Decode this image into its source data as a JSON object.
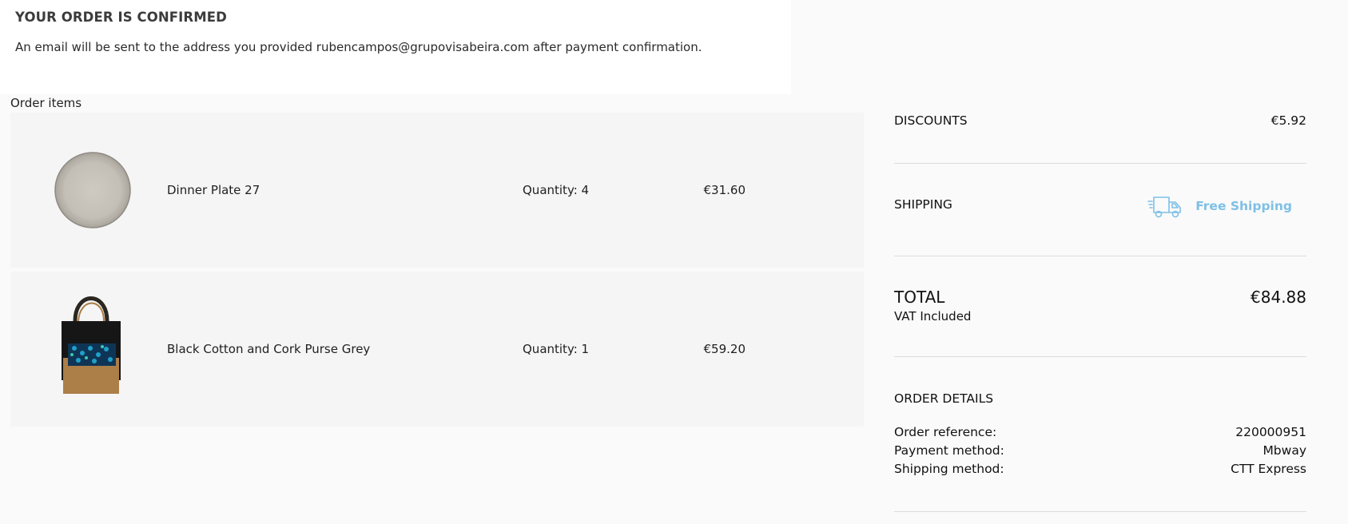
{
  "confirmation": {
    "title": "YOUR ORDER IS CONFIRMED",
    "message": "An email will be sent to the address you provided rubencampos@grupovisabeira.com after payment confirmation."
  },
  "order_items_label": "Order items",
  "items": [
    {
      "name": "Dinner Plate 27",
      "quantity": "Quantity: 4",
      "price": "€31.60",
      "image": "dinner-plate"
    },
    {
      "name": "Black Cotton and Cork Purse Grey",
      "quantity": "Quantity: 1",
      "price": "€59.20",
      "image": "tote-bag"
    }
  ],
  "summary": {
    "discounts_label": "DISCOUNTS",
    "discounts_value": "€5.92",
    "shipping_label": "SHIPPING",
    "shipping_value": "Free Shipping",
    "shipping_icon": "delivery-truck-icon",
    "total_label": "TOTAL",
    "total_value": "€84.88",
    "vat_note": "VAT Included"
  },
  "order_details": {
    "title": "ORDER DETAILS",
    "rows": [
      {
        "label": "Order reference:",
        "value": "220000951"
      },
      {
        "label": "Payment method:",
        "value": "Mbway"
      },
      {
        "label": "Shipping method:",
        "value": "CTT Express"
      }
    ]
  },
  "colors": {
    "free_shipping": "#7ec0e6",
    "divider": "#dcdcdc",
    "background": "#fafafa"
  }
}
